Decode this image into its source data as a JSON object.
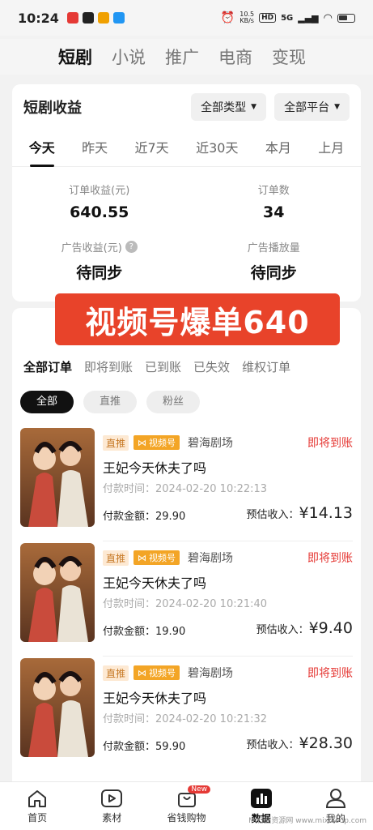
{
  "status_bar": {
    "time": "10:24",
    "net_speed_top": "10.5",
    "net_speed_unit": "KB/s",
    "hd": "HD",
    "signal": "5G"
  },
  "top_tabs": [
    "短剧",
    "小说",
    "推广",
    "电商",
    "变现"
  ],
  "summary": {
    "title": "短剧收益",
    "type_filter": "全部类型",
    "platform_filter": "全部平台",
    "periods": [
      "今天",
      "昨天",
      "近7天",
      "近30天",
      "本月",
      "上月"
    ],
    "stats": [
      {
        "label": "订单收益(元)",
        "value": "640.55"
      },
      {
        "label": "订单数",
        "value": "34"
      },
      {
        "label": "广告收益(元)",
        "value": "待同步"
      },
      {
        "label": "广告播放量",
        "value": "待同步"
      }
    ]
  },
  "banner": "视频号爆单640",
  "orders_section": {
    "tabs": [
      "全部订单",
      "即将到账",
      "已到账",
      "已失效",
      "维权订单"
    ],
    "chips": [
      "全部",
      "直推",
      "粉丝"
    ]
  },
  "orders": [
    {
      "tag": "直推",
      "channel": "视频号",
      "theatre": "碧海剧场",
      "status": "即将到账",
      "title": "王妃今天休夫了吗",
      "paytime": "付款时间：2024-02-20 10:22:13",
      "amount_label": "付款金额：",
      "amount": "29.90",
      "income_label": "预估收入：",
      "income": "¥14.13"
    },
    {
      "tag": "直推",
      "channel": "视频号",
      "theatre": "碧海剧场",
      "status": "即将到账",
      "title": "王妃今天休夫了吗",
      "paytime": "付款时间：2024-02-20 10:21:40",
      "amount_label": "付款金额：",
      "amount": "19.90",
      "income_label": "预估收入：",
      "income": "¥9.40"
    },
    {
      "tag": "直推",
      "channel": "视频号",
      "theatre": "碧海剧场",
      "status": "即将到账",
      "title": "王妃今天休夫了吗",
      "paytime": "付款时间：2024-02-20 10:21:32",
      "amount_label": "付款金额：",
      "amount": "59.90",
      "income_label": "预估收入：",
      "income": "¥28.30"
    }
  ],
  "bottom_nav": [
    {
      "label": "首页",
      "icon": "home-icon"
    },
    {
      "label": "素材",
      "icon": "play-icon"
    },
    {
      "label": "省钱购物",
      "icon": "bag-icon",
      "badge": "New"
    },
    {
      "label": "数据",
      "icon": "chart-icon"
    },
    {
      "label": "我的",
      "icon": "user-icon"
    }
  ],
  "watermark": "Mi行业资源网 www.mixiaodp.com"
}
